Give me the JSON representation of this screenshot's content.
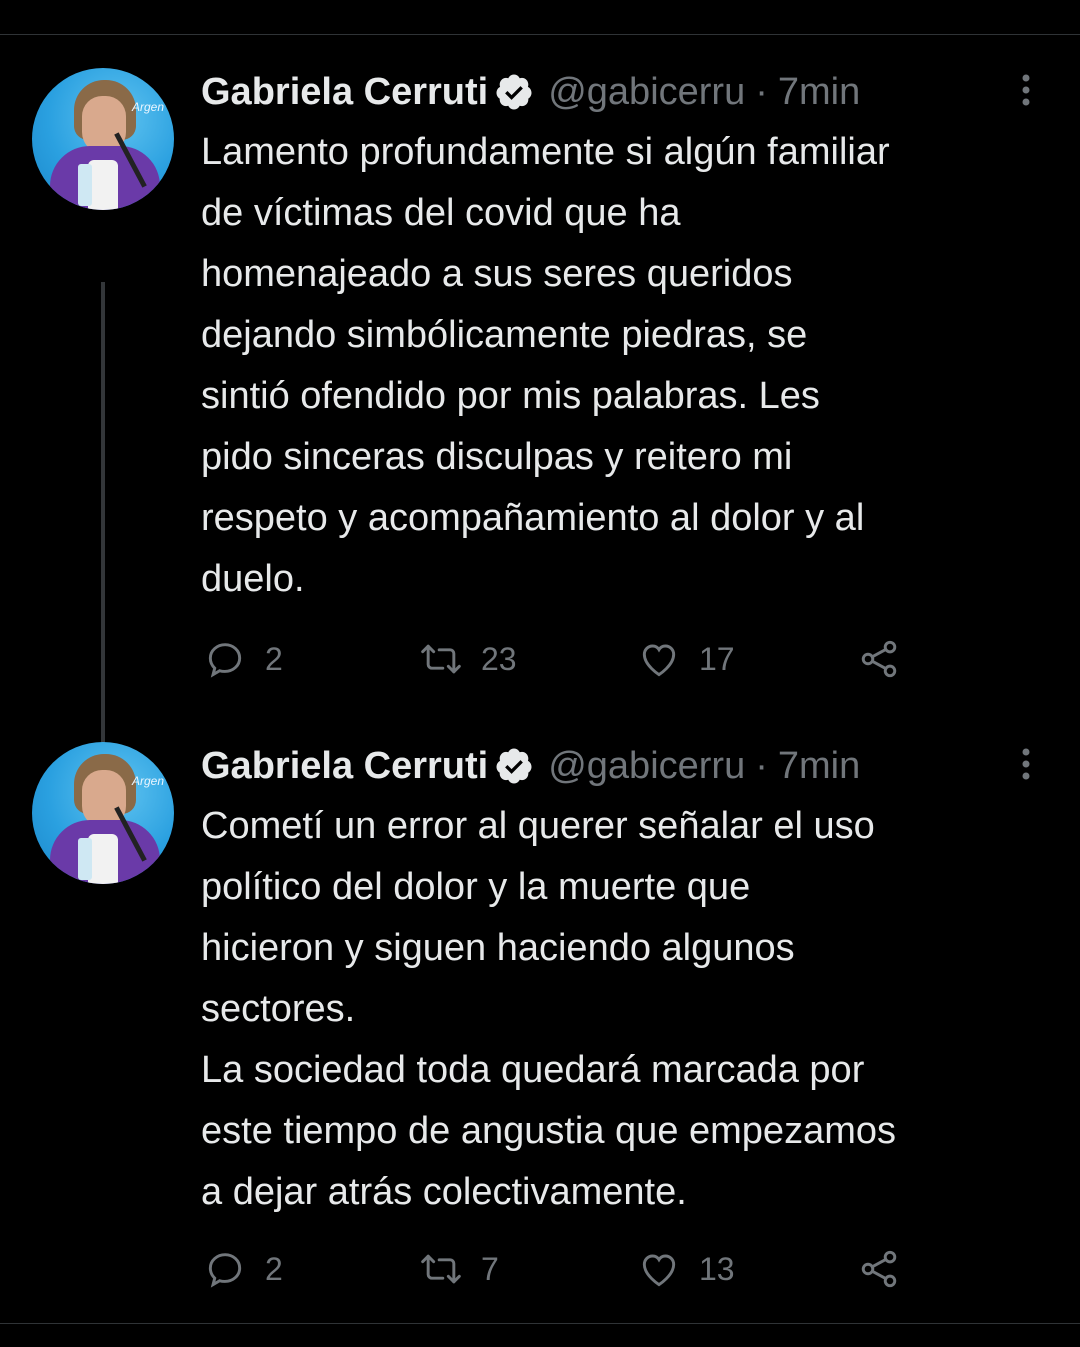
{
  "colors": {
    "background": "#000000",
    "text": "#e7e9ea",
    "secondary": "#71767b",
    "divider": "#2f3336",
    "verified_badge": "#e7e9ea"
  },
  "tweets": [
    {
      "author": {
        "name": "Gabriela Cerruti",
        "handle": "@gabicerru",
        "verified": true,
        "avatar_text": "Argen"
      },
      "separator": "·",
      "time": "7min",
      "text": "Lamento profundamente si algún familiar\nde víctimas del covid que ha\nhomenajeado  a sus seres queridos\ndejando simbólicamente piedras, se\nsintió ofendido por mis palabras. Les\npido sinceras disculpas y reitero mi\nrespeto y acompañamiento al dolor y al\nduelo.",
      "stats": {
        "replies": "2",
        "retweets": "23",
        "likes": "17"
      },
      "icons": [
        "reply-icon",
        "retweet-icon",
        "like-icon",
        "share-icon",
        "more-icon",
        "verified-icon"
      ]
    },
    {
      "author": {
        "name": "Gabriela Cerruti",
        "handle": "@gabicerru",
        "verified": true,
        "avatar_text": "Argen"
      },
      "separator": "·",
      "time": "7min",
      "text": "Cometí un error al querer señalar el uso\npolítico del dolor y la muerte que\nhicieron y siguen haciendo algunos\nsectores.\nLa sociedad toda quedará marcada por\neste tiempo de angustia que empezamos\na dejar atrás colectivamente.",
      "stats": {
        "replies": "2",
        "retweets": "7",
        "likes": "13"
      },
      "icons": [
        "reply-icon",
        "retweet-icon",
        "like-icon",
        "share-icon",
        "more-icon",
        "verified-icon"
      ]
    }
  ]
}
